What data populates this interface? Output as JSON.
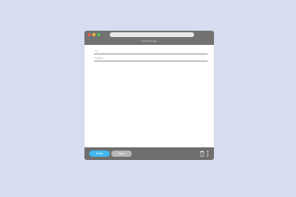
{
  "window": {
    "title": "New Message",
    "colors": {
      "titlebar": "#727272",
      "footer": "#6e6e6e",
      "close": "#f0584a",
      "minimize": "#f3b43c",
      "maximize": "#43c85f",
      "send": "#41b7f0",
      "save": "#b7b7b7"
    },
    "traffic_lights": [
      {
        "name": "close-button",
        "icon": "close-dot"
      },
      {
        "name": "minimize-button",
        "icon": "minimize-dot"
      },
      {
        "name": "maximize-button",
        "icon": "maximize-dot"
      }
    ]
  },
  "compose": {
    "to_placeholder": "To",
    "subject_placeholder": "Subject",
    "body": ""
  },
  "footer": {
    "send_label": "Send",
    "save_label": "Save",
    "trash_icon": "trash-icon",
    "more_icon": "more-vertical-icon"
  }
}
